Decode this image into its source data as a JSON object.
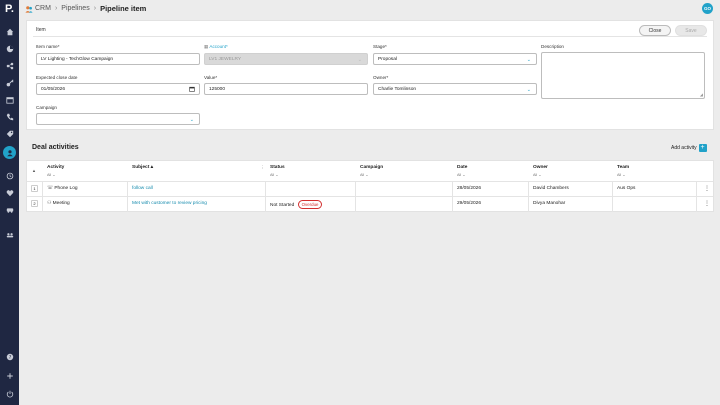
{
  "app": {
    "logo": "P."
  },
  "breadcrumb": {
    "items": [
      "CRM",
      "Pipelines"
    ],
    "current": "Pipeline item"
  },
  "user": {
    "initials": "GO"
  },
  "sidebar": {
    "icons": [
      "home-icon",
      "chart-icon",
      "share-icon",
      "key-icon",
      "calendar-icon",
      "phone-icon",
      "tag-icon",
      "contact-icon",
      "history-icon",
      "heart-icon",
      "truck-icon",
      "group-icon",
      "help-icon",
      "plus-icon",
      "logout-icon"
    ],
    "active": "contact-icon",
    "accent": "#21a2c9",
    "bg": "#1f2742"
  },
  "form": {
    "tab": "Item",
    "close_label": "Close",
    "save_label": "Save",
    "item_name": {
      "label": "Item name",
      "value": "LV Lighting - TechGlow Campaign"
    },
    "account": {
      "label": "Account",
      "value": "LV1 JEWELRY"
    },
    "stage": {
      "label": "Stage",
      "value": "Proposal"
    },
    "description": {
      "label": "Description",
      "value": ""
    },
    "expected_close_date": {
      "label": "Expected close date",
      "value": "01/05/2026"
    },
    "value": {
      "label": "Value",
      "value": "125000"
    },
    "owner": {
      "label": "Owner",
      "value": "Charlie Tomlinson"
    },
    "campaign": {
      "label": "Campaign",
      "value": ""
    }
  },
  "activities": {
    "title": "Deal activities",
    "add_label": "Add activity",
    "columns": [
      {
        "label": "Activity",
        "filter": "All"
      },
      {
        "label": "Subject",
        "filter": ""
      },
      {
        "label": "Status",
        "filter": "All"
      },
      {
        "label": "Campaign",
        "filter": "All"
      },
      {
        "label": "Date",
        "filter": "All"
      },
      {
        "label": "Owner",
        "filter": "All"
      },
      {
        "label": "Team",
        "filter": "All"
      }
    ],
    "rows": [
      {
        "index": "1",
        "activity": "Phone Log",
        "subject": "follow call",
        "status": "",
        "badge": "",
        "campaign": "",
        "date": "28/05/2026",
        "owner": "David Chambers",
        "team": "Aus Ops"
      },
      {
        "index": "2",
        "activity": "Meeting",
        "subject": "Met with customer to review pricing",
        "status": "Not Started",
        "badge": "Overdue",
        "campaign": "",
        "date": "29/05/2026",
        "owner": "Divya Manohar",
        "team": ""
      }
    ]
  }
}
